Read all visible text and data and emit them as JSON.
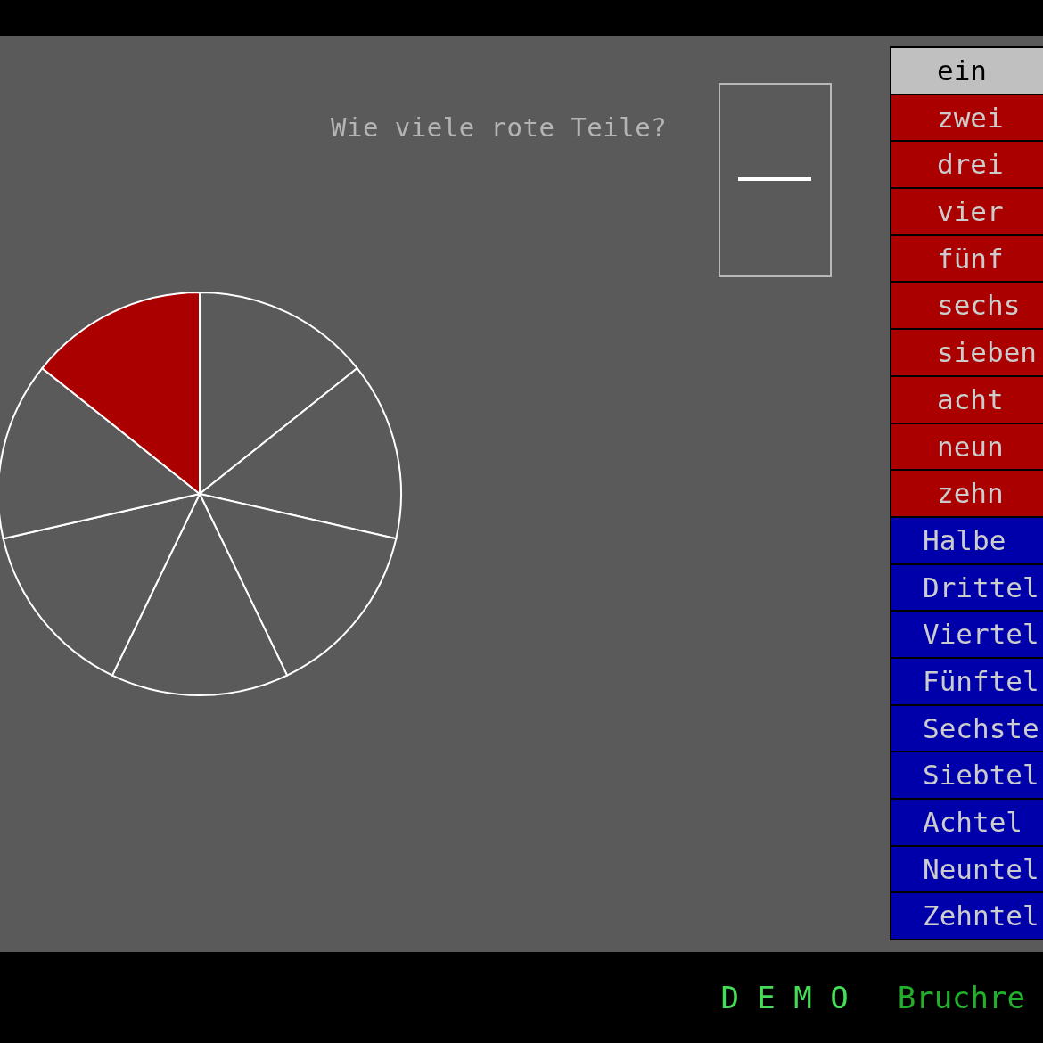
{
  "question": "Wie viele rote Teile?",
  "pie": {
    "slices": [
      {
        "red": false
      },
      {
        "red": false
      },
      {
        "red": false
      },
      {
        "red": false
      },
      {
        "red": false
      },
      {
        "red": false
      },
      {
        "red": true
      }
    ]
  },
  "words": [
    {
      "label": "ein",
      "kind": "numeral",
      "selected": true
    },
    {
      "label": "zwei",
      "kind": "numeral",
      "selected": false
    },
    {
      "label": "drei",
      "kind": "numeral",
      "selected": false
    },
    {
      "label": "vier",
      "kind": "numeral",
      "selected": false
    },
    {
      "label": "fünf",
      "kind": "numeral",
      "selected": false
    },
    {
      "label": "sechs",
      "kind": "numeral",
      "selected": false
    },
    {
      "label": "sieben",
      "kind": "numeral",
      "selected": false
    },
    {
      "label": "acht",
      "kind": "numeral",
      "selected": false
    },
    {
      "label": "neun",
      "kind": "numeral",
      "selected": false
    },
    {
      "label": "zehn",
      "kind": "numeral",
      "selected": false
    },
    {
      "label": "Halbe",
      "kind": "fraction",
      "selected": false
    },
    {
      "label": "Drittel",
      "kind": "fraction",
      "selected": false
    },
    {
      "label": "Viertel",
      "kind": "fraction",
      "selected": false
    },
    {
      "label": "Fünftel",
      "kind": "fraction",
      "selected": false
    },
    {
      "label": "Sechste",
      "kind": "fraction",
      "selected": false
    },
    {
      "label": "Siebtel",
      "kind": "fraction",
      "selected": false
    },
    {
      "label": "Achtel",
      "kind": "fraction",
      "selected": false
    },
    {
      "label": "Neuntel",
      "kind": "fraction",
      "selected": false
    },
    {
      "label": "Zehntel",
      "kind": "fraction",
      "selected": false
    }
  ],
  "status_bar": {
    "mode": "D E M O",
    "program": "Bruchre"
  }
}
